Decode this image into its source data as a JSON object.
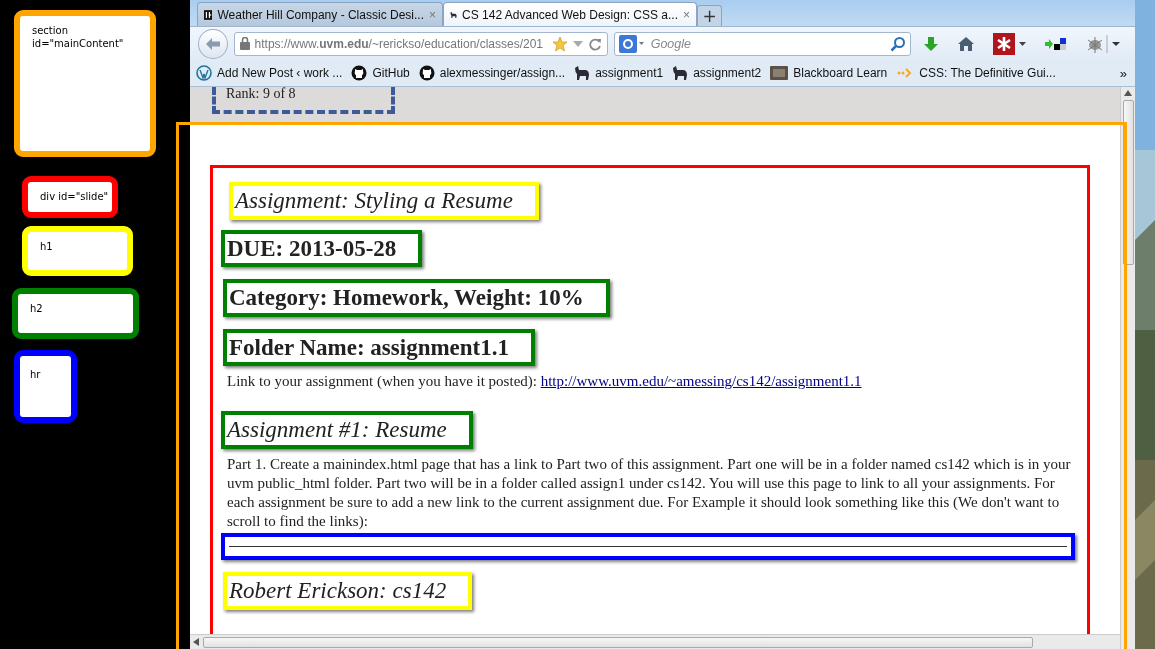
{
  "legend": [
    {
      "label": "section id=\"mainContent\"",
      "color": "#ffa500"
    },
    {
      "label": "div id=\"slide\"",
      "color": "#ff0000"
    },
    {
      "label": "h1",
      "color": "#ffff00"
    },
    {
      "label": "h2",
      "color": "#008000"
    },
    {
      "label": "hr",
      "color": "#0000ff"
    }
  ],
  "browser": {
    "tabs": [
      {
        "title": "Weather Hill Company - Classic Desi...",
        "selected": false,
        "kind": "square",
        "close": "×"
      },
      {
        "title": "CS 142 Advanced Web Design: CSS a...",
        "selected": true,
        "kind": "animal",
        "close": "×"
      }
    ],
    "new_tab": "+",
    "url": "https://www.**uvm.edu**/~rerickso/education/classes/201",
    "search": {
      "placeholder": "Google"
    },
    "bookmarks": [
      {
        "label": "Add New Post ‹ work ...",
        "kind": "wordpress"
      },
      {
        "label": "GitHub",
        "kind": "github"
      },
      {
        "label": "alexmessinger/assign...",
        "kind": "github"
      },
      {
        "label": "assignment1",
        "kind": "animal"
      },
      {
        "label": "assignment2",
        "kind": "animal"
      },
      {
        "label": "Blackboard Learn",
        "kind": "board"
      },
      {
        "label": "CSS: The Definitive Gui...",
        "kind": "dots"
      }
    ],
    "bookmarks_more": "»"
  },
  "page": {
    "stub": "Rank: 9 of 8",
    "blocks": [
      {
        "kind": "title",
        "text": "Assignment: Styling a Resume"
      },
      {
        "kind": "heading",
        "text": "DUE: 2013-05-28"
      },
      {
        "kind": "heading",
        "text": "Category: Homework, Weight: 10%"
      },
      {
        "kind": "heading",
        "text": "Folder Name: assignment1.1"
      },
      {
        "kind": "link",
        "label": "Link to your assignment (when you have it posted):",
        "url": "http://www.uvm.edu/~amessing/cs142/assignment1.1"
      },
      {
        "kind": "subhead",
        "text": "Assignment #1: Resume"
      },
      {
        "kind": "paragraph",
        "text": "Part 1. Create a mainindex.html page that has a link to Part two of this assignment. Part one will be in a folder named cs142 which is in your uvm public_html folder. Part two will be in a folder called assign1 under cs142. You will use this page to link to all your assignments. For each assignment be sure to add a new link to the current assignment due. For Example it should look something like this (We don't want to scroll to find the links):"
      },
      {
        "kind": "rule"
      },
      {
        "kind": "title",
        "text": "Robert Erickson: cs142"
      }
    ]
  }
}
